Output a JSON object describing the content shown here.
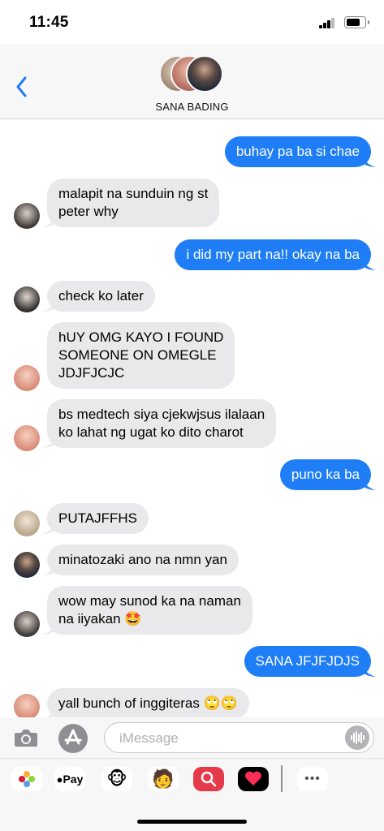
{
  "status": {
    "time": "11:45"
  },
  "header": {
    "group_name": "SANA BADING"
  },
  "messages": [
    {
      "dir": "out",
      "text": "buhay pa ba si chae"
    },
    {
      "dir": "in",
      "text": "malapit na sunduin ng st\npeter why"
    },
    {
      "dir": "out",
      "text": "i did my part na!! okay na ba"
    },
    {
      "dir": "in",
      "text": "check ko later"
    },
    {
      "dir": "in",
      "text": "hUY OMG KAYO I FOUND\nSOMEONE ON OMEGLE\nJDJFJCJC"
    },
    {
      "dir": "in",
      "text": "bs medtech siya cjekwjsus ilalaan\nko lahat ng ugat ko dito charot"
    },
    {
      "dir": "out",
      "text": "puno ka ba"
    },
    {
      "dir": "in",
      "text": "PUTAJFFHS"
    },
    {
      "dir": "in",
      "text": "minatozaki ano na nmn yan"
    },
    {
      "dir": "in",
      "text": "wow may sunod ka na naman\nna iiyakan 🤩"
    },
    {
      "dir": "out",
      "text": "SANA JFJFJDJS"
    },
    {
      "dir": "in",
      "text": "yall bunch of inggiteras 🙄🙄"
    }
  ],
  "composer": {
    "placeholder": "iMessage"
  },
  "drawer": {
    "apple_pay_label": "Pay",
    "more_label": "•••"
  },
  "colors": {
    "outgoing": "#1f7ef5",
    "incoming": "#e9e9eb",
    "accent": "#1f7ef5"
  },
  "icons": [
    "back-chevron-icon",
    "camera-icon",
    "app-store-icon",
    "voice-waveform-icon",
    "photos-icon",
    "apple-pay-icon",
    "memoji-monkey-icon",
    "memoji-person-icon",
    "search-images-icon",
    "digital-touch-icon",
    "more-apps-icon"
  ]
}
